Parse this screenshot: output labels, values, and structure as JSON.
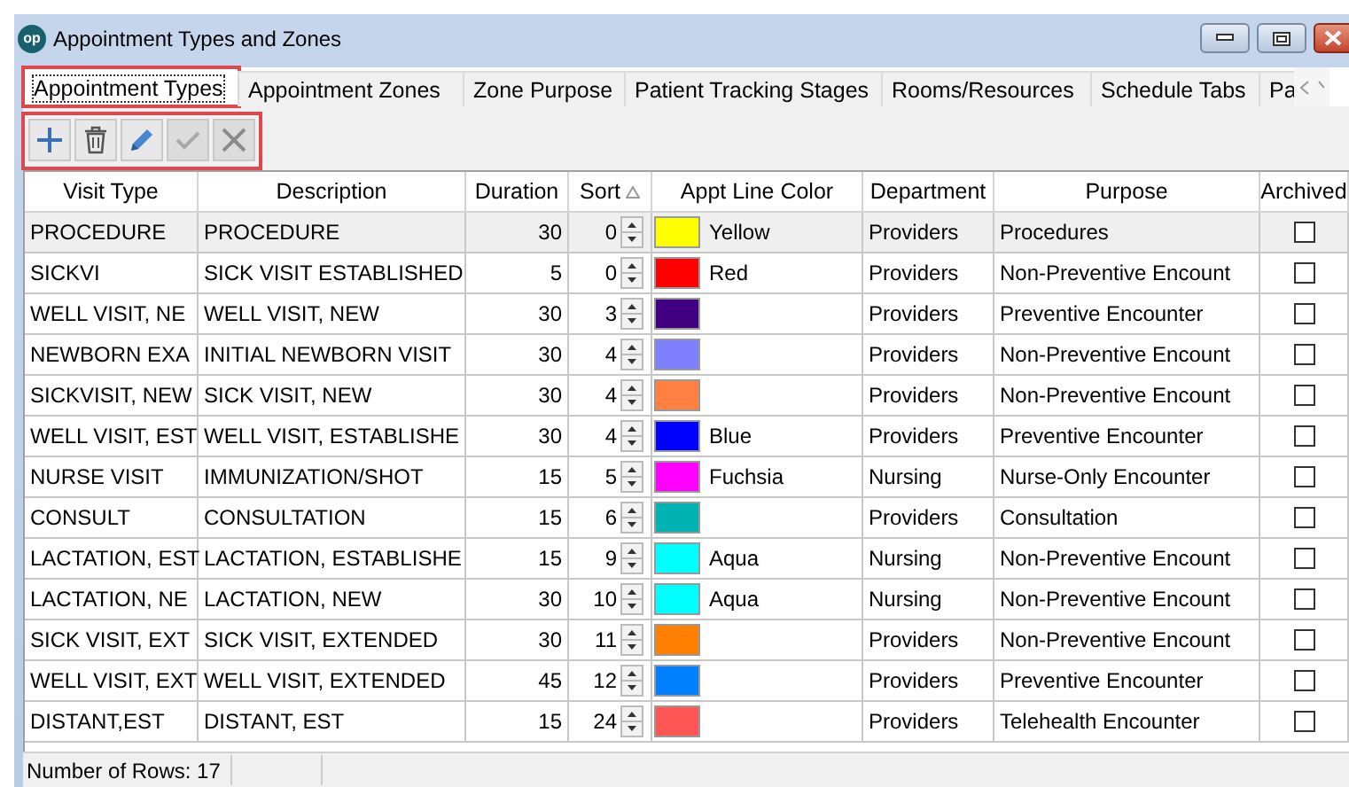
{
  "window": {
    "title": "Appointment Types and Zones",
    "logo": "op"
  },
  "tabs": [
    {
      "label": "Appointment Types",
      "selected": true,
      "highlighted": true
    },
    {
      "label": "Appointment Zones",
      "selected": false,
      "highlighted": false
    },
    {
      "label": "Zone Purpose",
      "selected": false,
      "highlighted": false
    },
    {
      "label": "Patient Tracking Stages",
      "selected": false,
      "highlighted": false
    },
    {
      "label": "Rooms/Resources",
      "selected": false,
      "highlighted": false
    },
    {
      "label": "Schedule Tabs",
      "selected": false,
      "highlighted": false
    },
    {
      "label": "Pa",
      "selected": false,
      "highlighted": false
    }
  ],
  "toolbar": {
    "highlighted": true,
    "buttons": [
      {
        "kind": "add",
        "disabled": false
      },
      {
        "kind": "delete",
        "disabled": false
      },
      {
        "kind": "edit",
        "disabled": false
      },
      {
        "kind": "save",
        "disabled": true
      },
      {
        "kind": "cancel",
        "disabled": true
      }
    ]
  },
  "table": {
    "columns": [
      {
        "label": "Visit Type",
        "sorted": false
      },
      {
        "label": "Description",
        "sorted": false
      },
      {
        "label": "Duration",
        "sorted": false
      },
      {
        "label": "Sort",
        "sorted": true
      },
      {
        "label": "Appt Line Color",
        "sorted": false
      },
      {
        "label": "Department",
        "sorted": false
      },
      {
        "label": "Purpose",
        "sorted": false
      },
      {
        "label": "Archived",
        "sorted": false
      }
    ],
    "rows": [
      {
        "visit_type": "PROCEDURE",
        "description": "PROCEDURE",
        "duration": "30",
        "sort": "0",
        "color": "#ffff00",
        "color_name": "Yellow",
        "department": "Providers",
        "purpose": "Procedures",
        "archived": false,
        "selected": true
      },
      {
        "visit_type": "SICKVI",
        "description": "SICK VISIT ESTABLISHED",
        "duration": "5",
        "sort": "0",
        "color": "#ff0000",
        "color_name": "Red",
        "department": "Providers",
        "purpose": "Non-Preventive Encount",
        "archived": false,
        "selected": false
      },
      {
        "visit_type": "WELL VISIT, NE",
        "description": "WELL VISIT, NEW",
        "duration": "30",
        "sort": "3",
        "color": "#400080",
        "department": "Providers",
        "purpose": "Preventive Encounter",
        "archived": false,
        "selected": false
      },
      {
        "visit_type": "NEWBORN EXA",
        "description": "INITIAL NEWBORN VISIT",
        "duration": "30",
        "sort": "4",
        "color": "#8080ff",
        "department": "Providers",
        "purpose": "Non-Preventive Encount",
        "archived": false,
        "selected": false
      },
      {
        "visit_type": "SICKVISIT, NEW",
        "description": "SICK VISIT, NEW",
        "duration": "30",
        "sort": "4",
        "color": "#ff8040",
        "department": "Providers",
        "purpose": "Non-Preventive Encount",
        "archived": false,
        "selected": false
      },
      {
        "visit_type": "WELL VISIT, EST",
        "description": "WELL VISIT, ESTABLISHE",
        "duration": "30",
        "sort": "4",
        "color": "#0000ff",
        "color_name": "Blue",
        "department": "Providers",
        "purpose": "Preventive Encounter",
        "archived": false,
        "selected": false
      },
      {
        "visit_type": "NURSE VISIT",
        "description": "IMMUNIZATION/SHOT",
        "duration": "15",
        "sort": "5",
        "color": "#ff00ff",
        "color_name": "Fuchsia",
        "department": "Nursing",
        "purpose": "Nurse-Only Encounter",
        "archived": false,
        "selected": false
      },
      {
        "visit_type": "CONSULT",
        "description": "CONSULTATION",
        "duration": "15",
        "sort": "6",
        "color": "#00b3b3",
        "department": "Providers",
        "purpose": "Consultation",
        "archived": false,
        "selected": false
      },
      {
        "visit_type": "LACTATION, EST",
        "description": "LACTATION, ESTABLISHE",
        "duration": "15",
        "sort": "9",
        "color": "#00ffff",
        "color_name": "Aqua",
        "department": "Nursing",
        "purpose": "Non-Preventive Encount",
        "archived": false,
        "selected": false
      },
      {
        "visit_type": "LACTATION, NE",
        "description": "LACTATION, NEW",
        "duration": "30",
        "sort": "10",
        "color": "#00ffff",
        "color_name": "Aqua",
        "department": "Nursing",
        "purpose": "Non-Preventive Encount",
        "archived": false,
        "selected": false
      },
      {
        "visit_type": "SICK VISIT, EXT",
        "description": "SICK VISIT, EXTENDED",
        "duration": "30",
        "sort": "11",
        "color": "#ff8000",
        "department": "Providers",
        "purpose": "Non-Preventive Encount",
        "archived": false,
        "selected": false
      },
      {
        "visit_type": "WELL VISIT, EXT",
        "description": "WELL VISIT, EXTENDED",
        "duration": "45",
        "sort": "12",
        "color": "#0080ff",
        "department": "Providers",
        "purpose": "Preventive Encounter",
        "archived": false,
        "selected": false
      },
      {
        "visit_type": "DISTANT,EST",
        "description": "DISTANT, EST",
        "duration": "15",
        "sort": "24",
        "color": "#ff5555",
        "department": "Providers",
        "purpose": "Telehealth Encounter",
        "archived": false,
        "selected": false
      }
    ]
  },
  "status_bar": {
    "text": "Number of Rows: 17"
  }
}
